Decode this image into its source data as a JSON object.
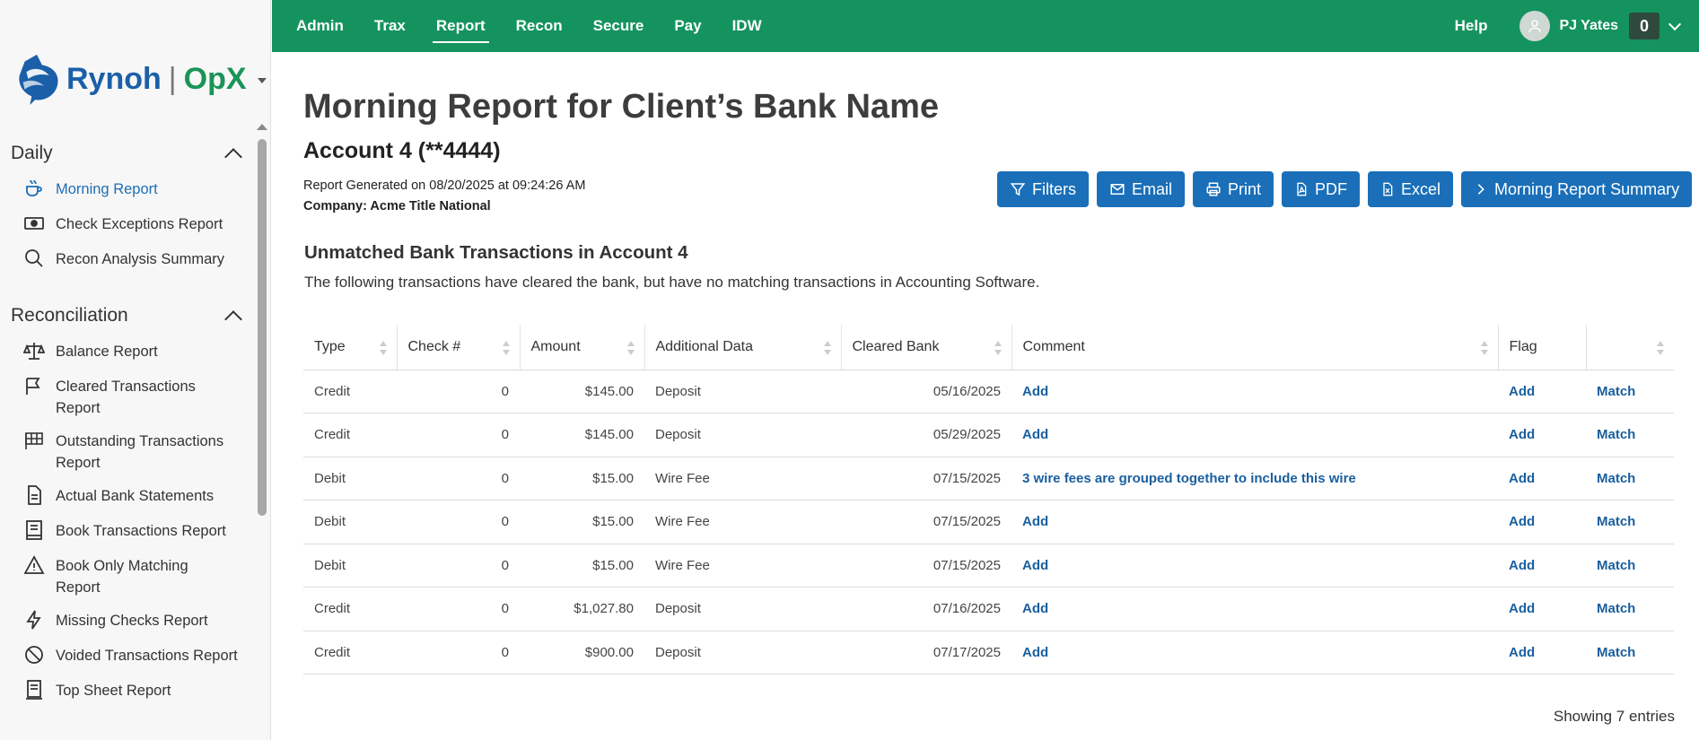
{
  "brand": {
    "name": "Rynoh",
    "product": "OpX",
    "separator": "|"
  },
  "topnav": {
    "tabs": [
      "Admin",
      "Trax",
      "Report",
      "Recon",
      "Secure",
      "Pay",
      "IDW"
    ],
    "active_tab": "Report",
    "help_label": "Help",
    "user_name": "PJ Yates",
    "notification_count": "0",
    "accent_color": "#14935f"
  },
  "sidebar": {
    "sections": [
      {
        "title": "Daily",
        "items": [
          {
            "label": "Morning Report",
            "icon": "coffee-cup-icon",
            "active": true
          },
          {
            "label": "Check Exceptions Report",
            "icon": "money-icon"
          },
          {
            "label": "Recon Analysis Summary",
            "icon": "search-icon"
          }
        ]
      },
      {
        "title": "Reconciliation",
        "items": [
          {
            "label": "Balance Report",
            "icon": "scale-icon"
          },
          {
            "label": "Cleared Transactions Report",
            "icon": "flag-icon"
          },
          {
            "label": "Outstanding Transactions Report",
            "icon": "checkered-flag-icon"
          },
          {
            "label": "Actual Bank Statements",
            "icon": "document-icon"
          },
          {
            "label": "Book Transactions Report",
            "icon": "book-icon"
          },
          {
            "label": "Book Only Matching Report",
            "icon": "warning-icon"
          },
          {
            "label": "Missing Checks Report",
            "icon": "lightning-icon"
          },
          {
            "label": "Voided Transactions Report",
            "icon": "ban-icon"
          },
          {
            "label": "Top Sheet Report",
            "icon": "sheet-icon"
          }
        ]
      }
    ]
  },
  "report": {
    "title": "Morning Report for Client’s Bank Name",
    "account": "Account 4 (**4444)",
    "generated": "Report Generated on 08/20/2025 at 09:24:26 AM",
    "company_label": "Company:",
    "company_value": "Acme Title National",
    "buttons": {
      "filters": "Filters",
      "email": "Email",
      "print": "Print",
      "pdf": "PDF",
      "excel": "Excel",
      "summary": "Morning Report Summary"
    },
    "section_title": "Unmatched Bank Transactions in Account 4",
    "section_desc": "The following transactions have cleared the bank, but have no matching transactions in Accounting Software.",
    "columns": [
      "Type",
      "Check #",
      "Amount",
      "Additional Data",
      "Cleared Bank",
      "Comment",
      "Flag",
      ""
    ],
    "rows": [
      {
        "type": "Credit",
        "check": "0",
        "amount": "$145.00",
        "data": "Deposit",
        "cleared": "05/16/2025",
        "comment": "Add",
        "flag": "Add",
        "action": "Match"
      },
      {
        "type": "Credit",
        "check": "0",
        "amount": "$145.00",
        "data": "Deposit",
        "cleared": "05/29/2025",
        "comment": "Add",
        "flag": "Add",
        "action": "Match"
      },
      {
        "type": "Debit",
        "check": "0",
        "amount": "$15.00",
        "data": "Wire Fee",
        "cleared": "07/15/2025",
        "comment": "3 wire fees are grouped together to include this wire",
        "flag": "Add",
        "action": "Match"
      },
      {
        "type": "Debit",
        "check": "0",
        "amount": "$15.00",
        "data": "Wire Fee",
        "cleared": "07/15/2025",
        "comment": "Add",
        "flag": "Add",
        "action": "Match"
      },
      {
        "type": "Debit",
        "check": "0",
        "amount": "$15.00",
        "data": "Wire Fee",
        "cleared": "07/15/2025",
        "comment": "Add",
        "flag": "Add",
        "action": "Match"
      },
      {
        "type": "Credit",
        "check": "0",
        "amount": "$1,027.80",
        "data": "Deposit",
        "cleared": "07/16/2025",
        "comment": "Add",
        "flag": "Add",
        "action": "Match"
      },
      {
        "type": "Credit",
        "check": "0",
        "amount": "$900.00",
        "data": "Deposit",
        "cleared": "07/17/2025",
        "comment": "Add",
        "flag": "Add",
        "action": "Match"
      }
    ],
    "footer": "Showing 7 entries"
  }
}
